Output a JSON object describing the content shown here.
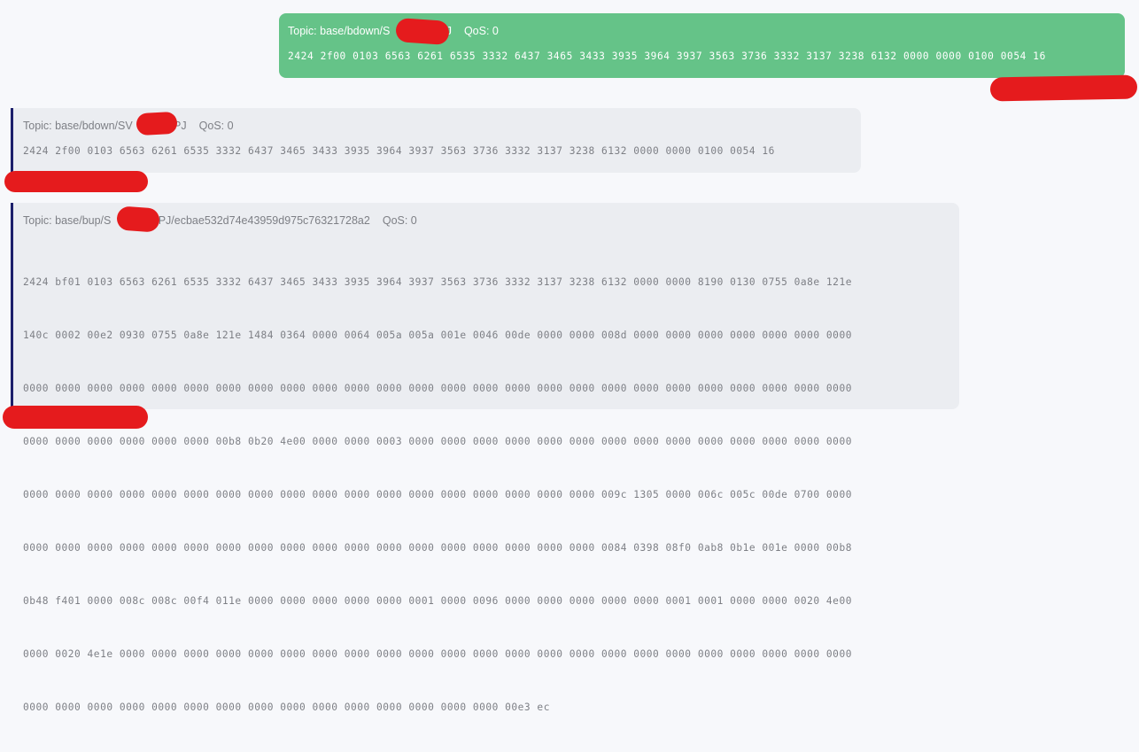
{
  "colors": {
    "page_background": "#f7f8fb",
    "sent_bubble": "#65c388",
    "received_bubble": "#ebedf1",
    "received_accent": "#1c1f6b",
    "redaction": "#e51b1d"
  },
  "messages": [
    {
      "direction": "sent",
      "topic_prefix": "Topic: base/bdown/S",
      "topic_suffix": "PJ",
      "qos": "QoS: 0",
      "payload": "2424 2f00 0103 6563 6261 6535 3332 6437 3465 3433 3935 3964 3937 3563 3736 3332 3137 3238 6132 0000 0000 0100 0054 16"
    },
    {
      "direction": "received",
      "topic_prefix": "Topic: base/bdown/SV",
      "topic_suffix": "APJ",
      "qos": "QoS: 0",
      "payload": "2424 2f00 0103 6563 6261 6535 3332 6437 3465 3433 3935 3964 3937 3563 3736 3332 3137 3238 6132 0000 0000 0100 0054 16"
    },
    {
      "direction": "received",
      "topic_prefix": "Topic: base/bup/S",
      "topic_suffix": "APJ/ecbae532d74e43959d975c76321728a2",
      "qos": "QoS: 0",
      "payload_lines": [
        "2424 bf01 0103 6563 6261 6535 3332 6437 3465 3433 3935 3964 3937 3563 3736 3332 3137 3238 6132 0000 0000 8190 0130 0755 0a8e 121e",
        "140c 0002 00e2 0930 0755 0a8e 121e 1484 0364 0000 0064 005a 005a 001e 0046 00de 0000 0000 008d 0000 0000 0000 0000 0000 0000 0000",
        "0000 0000 0000 0000 0000 0000 0000 0000 0000 0000 0000 0000 0000 0000 0000 0000 0000 0000 0000 0000 0000 0000 0000 0000 0000 0000",
        "0000 0000 0000 0000 0000 0000 00b8 0b20 4e00 0000 0000 0003 0000 0000 0000 0000 0000 0000 0000 0000 0000 0000 0000 0000 0000 0000",
        "0000 0000 0000 0000 0000 0000 0000 0000 0000 0000 0000 0000 0000 0000 0000 0000 0000 0000 009c 1305 0000 006c 005c 00de 0700 0000",
        "0000 0000 0000 0000 0000 0000 0000 0000 0000 0000 0000 0000 0000 0000 0000 0000 0000 0000 0084 0398 08f0 0ab8 0b1e 001e 0000 00b8",
        "0b48 f401 0000 008c 008c 00f4 011e 0000 0000 0000 0000 0000 0001 0000 0096 0000 0000 0000 0000 0000 0001 0001 0000 0000 0020 4e00",
        "0000 0020 4e1e 0000 0000 0000 0000 0000 0000 0000 0000 0000 0000 0000 0000 0000 0000 0000 0000 0000 0000 0000 0000 0000 0000 0000",
        "0000 0000 0000 0000 0000 0000 0000 0000 0000 0000 0000 0000 0000 0000 0000 00e3 ec"
      ]
    }
  ]
}
